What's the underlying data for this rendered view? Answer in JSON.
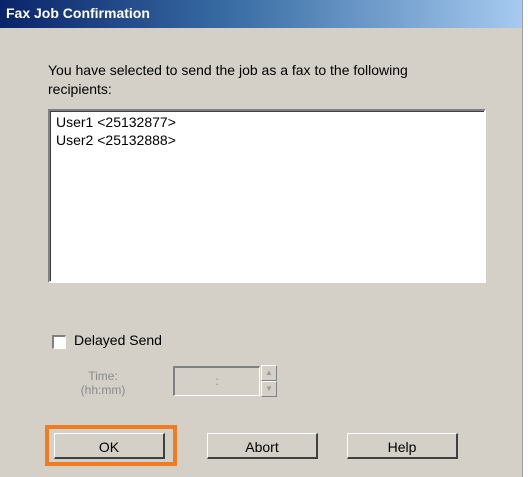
{
  "dialog": {
    "title": "Fax Job Confirmation",
    "message": "You have selected to send the job as a fax to the following recipients:",
    "recipients": [
      "User1 <25132877>",
      "User2 <25132888>"
    ],
    "delayed_send": {
      "label": "Delayed Send",
      "checked": false
    },
    "time": {
      "label_line1": "Time:",
      "label_line2": "(hh:mm)",
      "value": ":",
      "enabled": false
    },
    "buttons": {
      "ok": "OK",
      "abort": "Abort",
      "help": "Help"
    },
    "highlight_color": "#f07c22"
  }
}
